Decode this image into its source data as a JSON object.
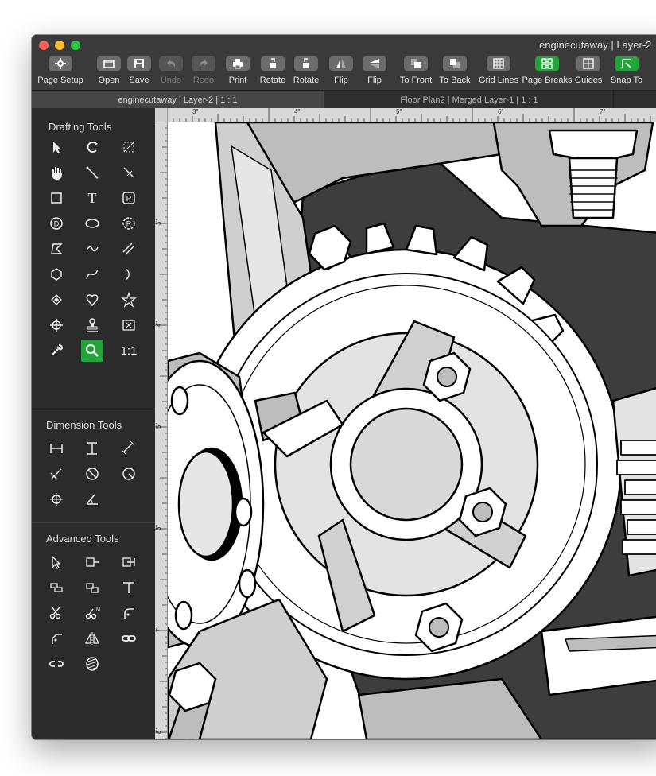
{
  "window": {
    "title": "enginecutaway | Layer-2"
  },
  "toolbar": [
    {
      "label": "Page Setup",
      "icon": "gear-icon"
    },
    {
      "label": "Open",
      "icon": "folder-icon"
    },
    {
      "label": "Save",
      "icon": "floppy-icon"
    },
    {
      "label": "Undo",
      "icon": "undo-icon",
      "disabled": true
    },
    {
      "label": "Redo",
      "icon": "redo-icon",
      "disabled": true
    },
    {
      "label": "Print",
      "icon": "printer-icon"
    },
    {
      "label": "Rotate",
      "icon": "rotate-left-icon"
    },
    {
      "label": "Rotate",
      "icon": "rotate-right-icon"
    },
    {
      "label": "Flip",
      "icon": "flip-horizontal-icon"
    },
    {
      "label": "Flip",
      "icon": "flip-vertical-icon"
    },
    {
      "label": "To Front",
      "icon": "bring-to-front-icon"
    },
    {
      "label": "To Back",
      "icon": "send-to-back-icon"
    },
    {
      "label": "Grid Lines",
      "icon": "grid-icon"
    },
    {
      "label": "Page Breaks",
      "icon": "page-breaks-icon",
      "active": true
    },
    {
      "label": "Guides",
      "icon": "guides-icon"
    },
    {
      "label": "Snap To",
      "icon": "snap-icon",
      "active": true
    }
  ],
  "tabs": [
    {
      "label": "enginecutaway | Layer-2 | 1 : 1",
      "active": true
    },
    {
      "label": "Floor Plan2 | Merged Layer-1 | 1 : 1",
      "active": false
    }
  ],
  "sidebar": {
    "drafting_title": "Drafting Tools",
    "drafting_tools": [
      "arrow-select-icon",
      "rotate-icon",
      "transform-icon",
      "hand-pan-icon",
      "line-icon",
      "perpendicular-line-icon",
      "rectangle-icon",
      "text-icon",
      "parcel-icon",
      "circle-diameter-icon",
      "ellipse-icon",
      "circle-radius-icon",
      "polygon-icon",
      "freehand-icon",
      "parallel-lines-icon",
      "regular-polygon-icon",
      "bezier-curve-icon",
      "arc-icon",
      "layers-icon",
      "heart-shape-icon",
      "star-icon",
      "crosshair-icon",
      "stamp-icon",
      "image-placeholder-icon",
      "eyedropper-icon",
      "zoom-icon",
      "actual-size-icon"
    ],
    "actual_size_label": "1:1",
    "dimension_title": "Dimension Tools",
    "dimension_tools": [
      "horizontal-dimension-icon",
      "vertical-dimension-icon",
      "aligned-dimension-icon",
      "angle-dimension-icon",
      "diameter-dimension-icon",
      "radius-dimension-icon",
      "center-mark-icon",
      "angular-dimension-icon"
    ],
    "advanced_title": "Advanced Tools",
    "advanced_tools": [
      "node-edit-icon",
      "extend-left-icon",
      "extend-right-icon",
      "join-segments-icon",
      "break-segments-icon",
      "trim-icon",
      "cut-icon",
      "cut-measure-icon",
      "fillet-icon",
      "chamfer-icon",
      "mirror-icon",
      "link-icon",
      "unlink-icon",
      "hatch-icon"
    ]
  },
  "rulers": {
    "horizontal": [
      "3\"",
      "4\"",
      "5\"",
      "6\"",
      "7\""
    ],
    "vertical": [
      "3\"",
      "4\"",
      "5\"",
      "6\"",
      "7\"",
      "8\""
    ]
  },
  "colors": {
    "accent_green": "#21a53b",
    "close": "#fe5f57",
    "minimize": "#febc2e",
    "zoom": "#28c840"
  }
}
